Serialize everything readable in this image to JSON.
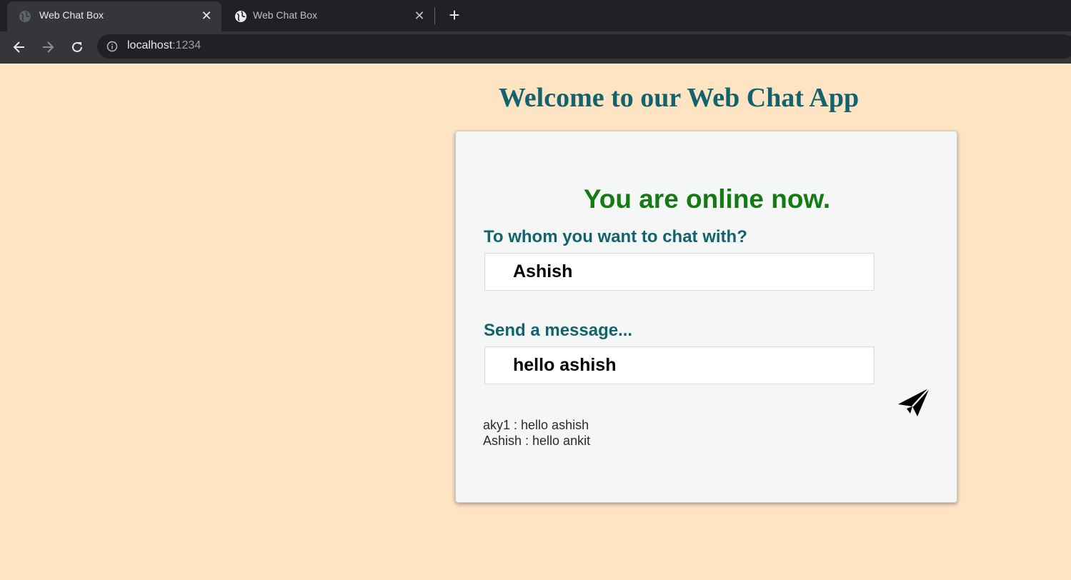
{
  "browser": {
    "tabs": [
      {
        "title": "Web Chat Box",
        "active": true,
        "icon": "globe-icon"
      },
      {
        "title": "Web Chat Box",
        "active": false,
        "icon": "globe-icon"
      }
    ],
    "close_glyph": "✕",
    "new_tab_glyph": "+",
    "url_host": "localhost",
    "url_port": ":1234"
  },
  "page": {
    "heading": "Welcome to our Web Chat App",
    "status": "You are online now.",
    "recipient_label": "To whom you want to chat with?",
    "recipient_value": "Ashish",
    "message_label": "Send a message...",
    "message_value": "hello ashish",
    "send_icon": "paper-plane-icon",
    "messages": [
      "aky1 : hello ashish",
      "Ashish : hello ankit"
    ]
  },
  "colors": {
    "page_background": "#ffe4c4",
    "heading": "#11646e",
    "status": "#147a14",
    "card": "#f5f6f6"
  }
}
